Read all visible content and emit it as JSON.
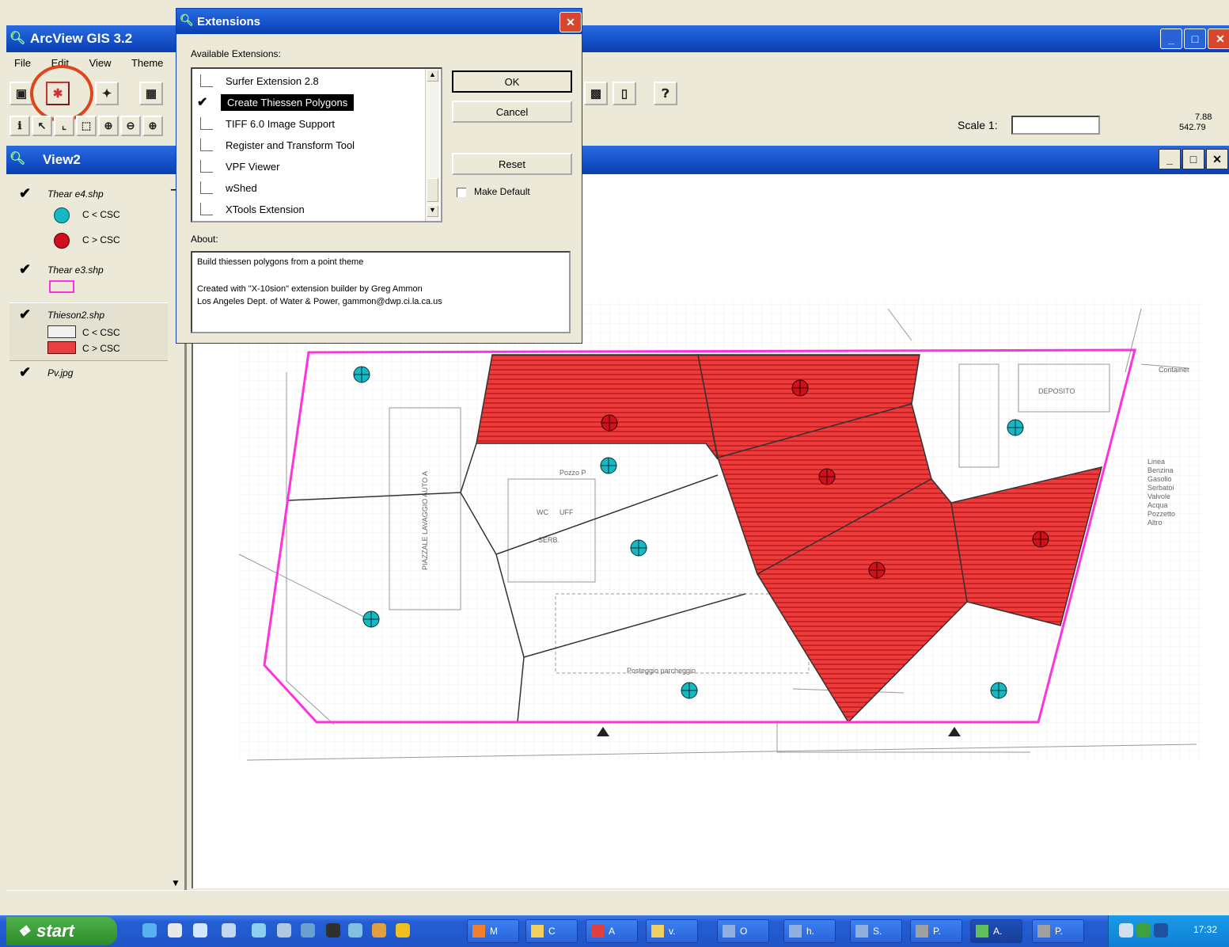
{
  "app": {
    "title": "ArcView GIS 3.2",
    "menu": [
      "File",
      "Edit",
      "View",
      "Theme"
    ],
    "scale_label": "Scale 1:",
    "scale_value": "",
    "coords": [
      "7.88",
      "542.79"
    ]
  },
  "view": {
    "title": "View2",
    "legend": [
      {
        "name": "Thear e4.shp",
        "checked": true,
        "items": [
          {
            "label": "C < CSC",
            "color": "#17b7c4",
            "symbol": "point"
          },
          {
            "label": "C > CSC",
            "color": "#d0101c",
            "symbol": "point"
          }
        ]
      },
      {
        "name": "Thear e3.shp",
        "checked": true,
        "items": [
          {
            "label": "",
            "color": "#ff33dd",
            "symbol": "outline"
          }
        ]
      },
      {
        "name": "Thieson2.shp",
        "checked": true,
        "items": [
          {
            "label": "C < CSC",
            "color": "#f0f0f0",
            "symbol": "polygon"
          },
          {
            "label": "C > CSC",
            "color": "#e84040",
            "symbol": "polygon"
          }
        ]
      },
      {
        "name": "Pv.jpg",
        "checked": true,
        "items": []
      }
    ]
  },
  "extensions_dialog": {
    "title": "Extensions",
    "available_label": "Available Extensions:",
    "items": [
      {
        "label": "Surfer Extension 2.8",
        "checked": false
      },
      {
        "label": "Create Thiessen Polygons",
        "checked": true,
        "selected": true
      },
      {
        "label": "TIFF 6.0 Image Support",
        "checked": false
      },
      {
        "label": "Register and Transform Tool",
        "checked": false
      },
      {
        "label": "VPF Viewer",
        "checked": false
      },
      {
        "label": "wShed",
        "checked": false
      },
      {
        "label": "XTools Extension",
        "checked": false
      }
    ],
    "ok_label": "OK",
    "cancel_label": "Cancel",
    "reset_label": "Reset",
    "make_default_label": "Make Default",
    "about_label": "About:",
    "about_line1": "Build thiessen polygons from a point theme",
    "about_line2": "Created with \"X-10sion\" extension builder by Greg Ammon",
    "about_line3": "Los Angeles Dept. of Water & Power, gammon@dwp.ci.la.ca.us"
  },
  "map_labels": {
    "pozzo": "Pozzo P",
    "vertical_text": "PIAZZALE LAVAGGIO AUTO A",
    "wc": "WC",
    "uff": "UFF",
    "tank": "SERB.",
    "right_legend": [
      "Linea",
      "Benzina",
      "Gasolio",
      "Serbatoi",
      "Valvole",
      "Acqua",
      "Pozzetto",
      "Altro"
    ],
    "parcheggio": "Posteggio parcheggio",
    "container": "Container",
    "deposito": "DEPOSITO"
  },
  "taskbar": {
    "start_label": "start",
    "buttons": [
      "M",
      "C",
      "A",
      "v.",
      "O",
      "h.",
      "S.",
      "P.",
      "A.",
      "P."
    ],
    "clock": "17:32"
  }
}
